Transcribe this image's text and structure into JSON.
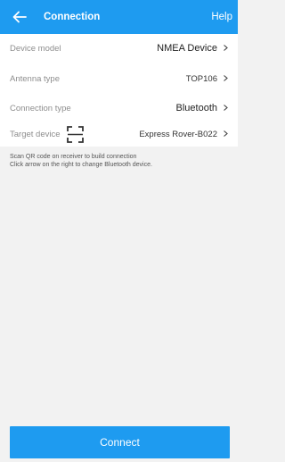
{
  "header": {
    "title": "Connection",
    "help_label": "Help"
  },
  "settings": [
    {
      "label": "Device model",
      "value": "NMEA Device"
    },
    {
      "label": "Antenna type",
      "value": "TOP106"
    },
    {
      "label": "Connection type",
      "value": "Bluetooth"
    },
    {
      "label": "Target device",
      "value": "Express Rover-B022"
    }
  ],
  "hint": {
    "line1": "Scan QR code on receiver to build connection",
    "line2": "Click arrow on the right to change Bluetooth device."
  },
  "connect_label": "Connect",
  "colors": {
    "accent": "#1e9bf0",
    "background": "#f2f2f2"
  }
}
